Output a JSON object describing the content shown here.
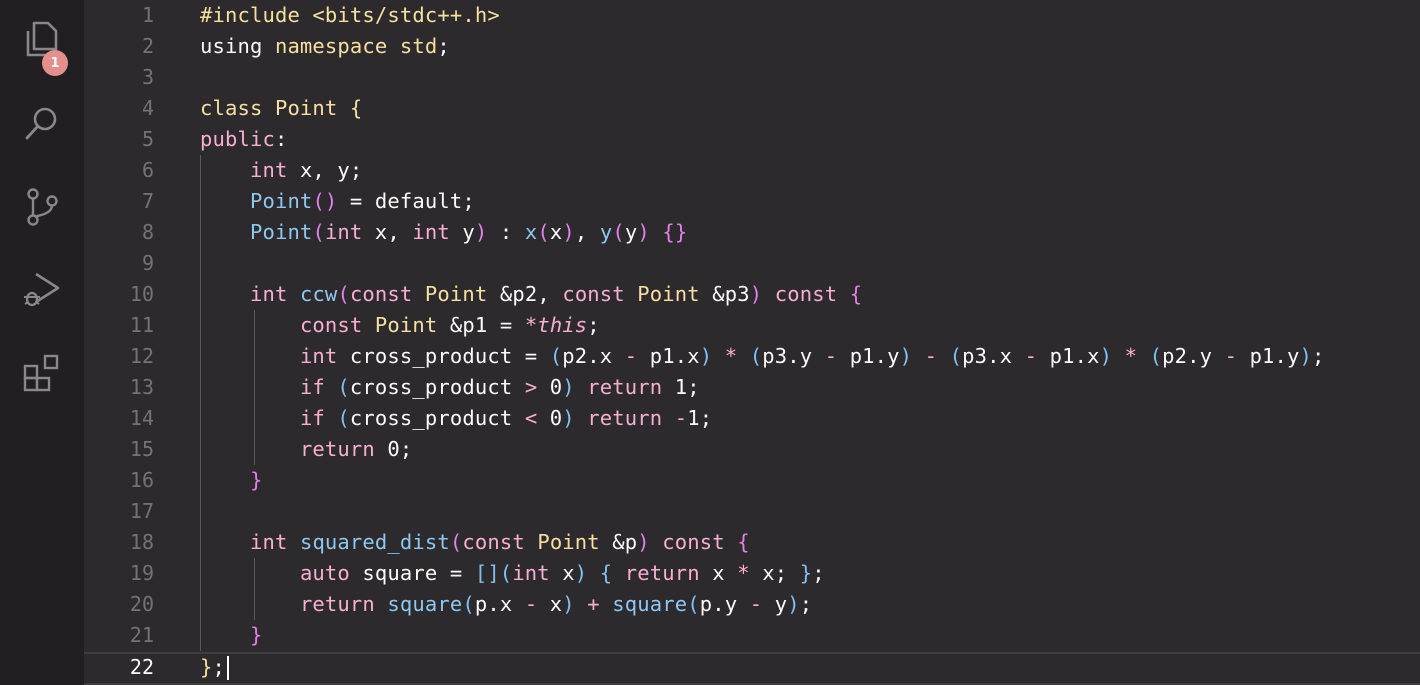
{
  "activity_bar": {
    "items": [
      {
        "name": "explorer",
        "icon": "files-icon",
        "badge": "1"
      },
      {
        "name": "search",
        "icon": "search-icon"
      },
      {
        "name": "source-control",
        "icon": "source-control-icon"
      },
      {
        "name": "run-debug",
        "icon": "run-debug-icon"
      },
      {
        "name": "extensions",
        "icon": "extensions-icon"
      }
    ]
  },
  "editor": {
    "language": "cpp",
    "current_line": 22,
    "colors": {
      "background": "#2d2a2e",
      "keyword": "#f7aed2",
      "type": "#f5e0a0",
      "function": "#8fc7f0",
      "text": "#fcfcfa"
    },
    "lines": [
      {
        "num": "1",
        "tokens": [
          [
            "t-ty",
            "#include <bits/stdc++.h>"
          ]
        ]
      },
      {
        "num": "2",
        "tokens": [
          [
            "t-pl",
            "using "
          ],
          [
            "t-ty",
            "namespace"
          ],
          [
            "t-pl",
            " "
          ],
          [
            "t-ty",
            "std"
          ],
          [
            "t-pl",
            ";"
          ]
        ]
      },
      {
        "num": "3",
        "tokens": []
      },
      {
        "num": "4",
        "tokens": [
          [
            "t-ty",
            "class "
          ],
          [
            "t-ty",
            "Point"
          ],
          [
            "t-pl",
            " "
          ],
          [
            "t-b1",
            "{"
          ]
        ]
      },
      {
        "num": "5",
        "tokens": [
          [
            "t-kw",
            "public"
          ],
          [
            "t-pl",
            ":"
          ]
        ]
      },
      {
        "num": "6",
        "tokens": [
          [
            "t-pl",
            "    "
          ],
          [
            "t-kw",
            "int"
          ],
          [
            "t-pl",
            " x, y;"
          ]
        ]
      },
      {
        "num": "7",
        "tokens": [
          [
            "t-pl",
            "    "
          ],
          [
            "t-fn",
            "Point"
          ],
          [
            "t-b2",
            "()"
          ],
          [
            "t-pl",
            " = default;"
          ]
        ]
      },
      {
        "num": "8",
        "tokens": [
          [
            "t-pl",
            "    "
          ],
          [
            "t-fn",
            "Point"
          ],
          [
            "t-b2",
            "("
          ],
          [
            "t-kw",
            "int"
          ],
          [
            "t-pl",
            " x, "
          ],
          [
            "t-kw",
            "int"
          ],
          [
            "t-pl",
            " y"
          ],
          [
            "t-b2",
            ")"
          ],
          [
            "t-pl",
            " : "
          ],
          [
            "t-fn",
            "x"
          ],
          [
            "t-b2",
            "("
          ],
          [
            "t-pl",
            "x"
          ],
          [
            "t-b2",
            ")"
          ],
          [
            "t-pl",
            ", "
          ],
          [
            "t-fn",
            "y"
          ],
          [
            "t-b2",
            "("
          ],
          [
            "t-pl",
            "y"
          ],
          [
            "t-b2",
            ")"
          ],
          [
            "t-pl",
            " "
          ],
          [
            "t-b2",
            "{}"
          ]
        ]
      },
      {
        "num": "9",
        "tokens": []
      },
      {
        "num": "10",
        "tokens": [
          [
            "t-pl",
            "    "
          ],
          [
            "t-kw",
            "int"
          ],
          [
            "t-pl",
            " "
          ],
          [
            "t-fn",
            "ccw"
          ],
          [
            "t-b2",
            "("
          ],
          [
            "t-kw",
            "const"
          ],
          [
            "t-pl",
            " "
          ],
          [
            "t-ty",
            "Point"
          ],
          [
            "t-pl",
            " &p2, "
          ],
          [
            "t-kw",
            "const"
          ],
          [
            "t-pl",
            " "
          ],
          [
            "t-ty",
            "Point"
          ],
          [
            "t-pl",
            " &p3"
          ],
          [
            "t-b2",
            ")"
          ],
          [
            "t-pl",
            " "
          ],
          [
            "t-kw",
            "const"
          ],
          [
            "t-pl",
            " "
          ],
          [
            "t-b2",
            "{"
          ]
        ]
      },
      {
        "num": "11",
        "tokens": [
          [
            "t-pl",
            "        "
          ],
          [
            "t-kw",
            "const"
          ],
          [
            "t-pl",
            " "
          ],
          [
            "t-ty",
            "Point"
          ],
          [
            "t-pl",
            " &p1 = "
          ],
          [
            "t-op",
            "*"
          ],
          [
            "t-it",
            "this"
          ],
          [
            "t-pl",
            ";"
          ]
        ]
      },
      {
        "num": "12",
        "tokens": [
          [
            "t-pl",
            "        "
          ],
          [
            "t-kw",
            "int"
          ],
          [
            "t-pl",
            " cross_product = "
          ],
          [
            "t-b3",
            "("
          ],
          [
            "t-pl",
            "p2.x "
          ],
          [
            "t-op",
            "-"
          ],
          [
            "t-pl",
            " p1.x"
          ],
          [
            "t-b3",
            ")"
          ],
          [
            "t-pl",
            " "
          ],
          [
            "t-op",
            "*"
          ],
          [
            "t-pl",
            " "
          ],
          [
            "t-b3",
            "("
          ],
          [
            "t-pl",
            "p3.y "
          ],
          [
            "t-op",
            "-"
          ],
          [
            "t-pl",
            " p1.y"
          ],
          [
            "t-b3",
            ")"
          ],
          [
            "t-pl",
            " "
          ],
          [
            "t-op",
            "-"
          ],
          [
            "t-pl",
            " "
          ],
          [
            "t-b3",
            "("
          ],
          [
            "t-pl",
            "p3.x "
          ],
          [
            "t-op",
            "-"
          ],
          [
            "t-pl",
            " p1.x"
          ],
          [
            "t-b3",
            ")"
          ],
          [
            "t-pl",
            " "
          ],
          [
            "t-op",
            "*"
          ],
          [
            "t-pl",
            " "
          ],
          [
            "t-b3",
            "("
          ],
          [
            "t-pl",
            "p2.y "
          ],
          [
            "t-op",
            "-"
          ],
          [
            "t-pl",
            " p1.y"
          ],
          [
            "t-b3",
            ")"
          ],
          [
            "t-pl",
            ";"
          ]
        ]
      },
      {
        "num": "13",
        "tokens": [
          [
            "t-pl",
            "        "
          ],
          [
            "t-kw",
            "if"
          ],
          [
            "t-pl",
            " "
          ],
          [
            "t-b3",
            "("
          ],
          [
            "t-pl",
            "cross_product "
          ],
          [
            "t-op",
            ">"
          ],
          [
            "t-pl",
            " 0"
          ],
          [
            "t-b3",
            ")"
          ],
          [
            "t-pl",
            " "
          ],
          [
            "t-kw",
            "return"
          ],
          [
            "t-pl",
            " 1;"
          ]
        ]
      },
      {
        "num": "14",
        "tokens": [
          [
            "t-pl",
            "        "
          ],
          [
            "t-kw",
            "if"
          ],
          [
            "t-pl",
            " "
          ],
          [
            "t-b3",
            "("
          ],
          [
            "t-pl",
            "cross_product "
          ],
          [
            "t-op",
            "<"
          ],
          [
            "t-pl",
            " 0"
          ],
          [
            "t-b3",
            ")"
          ],
          [
            "t-pl",
            " "
          ],
          [
            "t-kw",
            "return"
          ],
          [
            "t-pl",
            " "
          ],
          [
            "t-op",
            "-"
          ],
          [
            "t-pl",
            "1;"
          ]
        ]
      },
      {
        "num": "15",
        "tokens": [
          [
            "t-pl",
            "        "
          ],
          [
            "t-kw",
            "return"
          ],
          [
            "t-pl",
            " 0;"
          ]
        ]
      },
      {
        "num": "16",
        "tokens": [
          [
            "t-pl",
            "    "
          ],
          [
            "t-b2",
            "}"
          ]
        ]
      },
      {
        "num": "17",
        "tokens": []
      },
      {
        "num": "18",
        "tokens": [
          [
            "t-pl",
            "    "
          ],
          [
            "t-kw",
            "int"
          ],
          [
            "t-pl",
            " "
          ],
          [
            "t-fn",
            "squared_dist"
          ],
          [
            "t-b2",
            "("
          ],
          [
            "t-kw",
            "const"
          ],
          [
            "t-pl",
            " "
          ],
          [
            "t-ty",
            "Point"
          ],
          [
            "t-pl",
            " &p"
          ],
          [
            "t-b2",
            ")"
          ],
          [
            "t-pl",
            " "
          ],
          [
            "t-kw",
            "const"
          ],
          [
            "t-pl",
            " "
          ],
          [
            "t-b2",
            "{"
          ]
        ]
      },
      {
        "num": "19",
        "tokens": [
          [
            "t-pl",
            "        "
          ],
          [
            "t-kw",
            "auto"
          ],
          [
            "t-pl",
            " square = "
          ],
          [
            "t-b3",
            "[]("
          ],
          [
            "t-kw",
            "int"
          ],
          [
            "t-pl",
            " x"
          ],
          [
            "t-b3",
            ")"
          ],
          [
            "t-pl",
            " "
          ],
          [
            "t-b3",
            "{"
          ],
          [
            "t-pl",
            " "
          ],
          [
            "t-kw",
            "return"
          ],
          [
            "t-pl",
            " x "
          ],
          [
            "t-op",
            "*"
          ],
          [
            "t-pl",
            " x; "
          ],
          [
            "t-b3",
            "}"
          ],
          [
            "t-pl",
            ";"
          ]
        ]
      },
      {
        "num": "20",
        "tokens": [
          [
            "t-pl",
            "        "
          ],
          [
            "t-kw",
            "return"
          ],
          [
            "t-pl",
            " "
          ],
          [
            "t-fn",
            "square"
          ],
          [
            "t-b3",
            "("
          ],
          [
            "t-pl",
            "p.x "
          ],
          [
            "t-op",
            "-"
          ],
          [
            "t-pl",
            " x"
          ],
          [
            "t-b3",
            ")"
          ],
          [
            "t-pl",
            " "
          ],
          [
            "t-op",
            "+"
          ],
          [
            "t-pl",
            " "
          ],
          [
            "t-fn",
            "square"
          ],
          [
            "t-b3",
            "("
          ],
          [
            "t-pl",
            "p.y "
          ],
          [
            "t-op",
            "-"
          ],
          [
            "t-pl",
            " y"
          ],
          [
            "t-b3",
            ")"
          ],
          [
            "t-pl",
            ";"
          ]
        ]
      },
      {
        "num": "21",
        "tokens": [
          [
            "t-pl",
            "    "
          ],
          [
            "t-b2",
            "}"
          ]
        ]
      },
      {
        "num": "22",
        "tokens": [
          [
            "t-b1",
            "}"
          ],
          [
            "t-pl",
            ";"
          ]
        ]
      }
    ]
  }
}
